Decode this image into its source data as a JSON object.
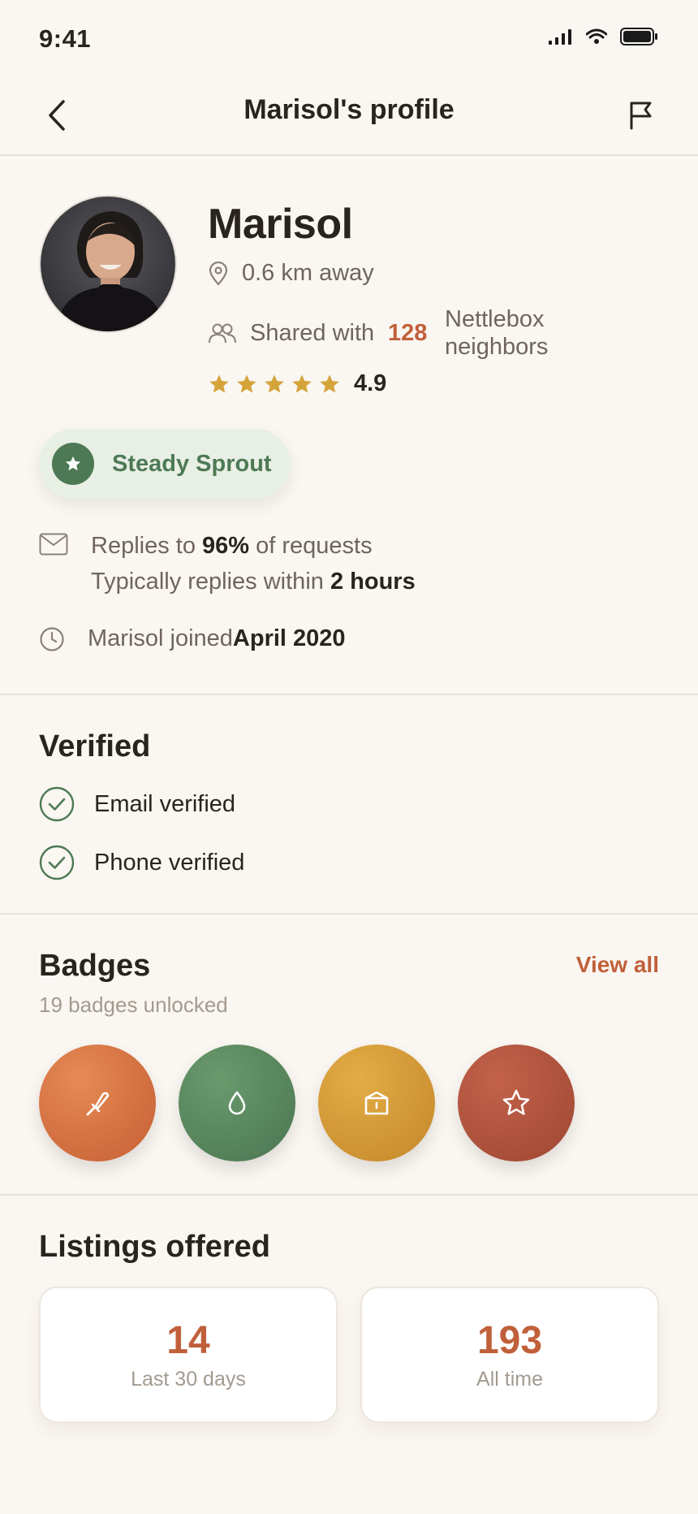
{
  "status_bar": {
    "time": "9:41"
  },
  "nav": {
    "title": "Marisol's profile"
  },
  "profile": {
    "name": "Marisol",
    "distance": "0.6 km away",
    "shared_label": "Shared with",
    "shared_count": "128",
    "shared_suffix": "Nettlebox neighbors",
    "rating": "4.9",
    "stars": 5
  },
  "level_badge": {
    "label": "Steady Sprout"
  },
  "responsiveness": {
    "replies_prefix": "Replies to ",
    "replies_rate": "96%",
    "replies_suffix": " of requests",
    "time_prefix": "Typically replies within ",
    "time_value": "2 hours"
  },
  "joined": {
    "prefix": "Marisol joined ",
    "date": "April 2020"
  },
  "verified": {
    "title": "Verified",
    "items": [
      "Email verified",
      "Phone verified"
    ]
  },
  "badges": {
    "title": "Badges",
    "view_all": "View all",
    "subtitle": "19 badges unlocked",
    "items": [
      {
        "icon": "trowel-icon",
        "color": "#d9703f"
      },
      {
        "icon": "droplet-icon",
        "color": "#5a855e"
      },
      {
        "icon": "box-icon",
        "color": "#d49a34"
      },
      {
        "icon": "star-icon",
        "color": "#b5553b"
      }
    ]
  },
  "listings": {
    "title": "Listings offered",
    "cards": [
      {
        "value": "14",
        "label": "Last 30 days"
      },
      {
        "value": "193",
        "label": "All time"
      }
    ]
  },
  "colors": {
    "accent": "#c0603a",
    "green": "#4d7a55",
    "star": "#d4a43b",
    "background": "#faf6f1"
  }
}
